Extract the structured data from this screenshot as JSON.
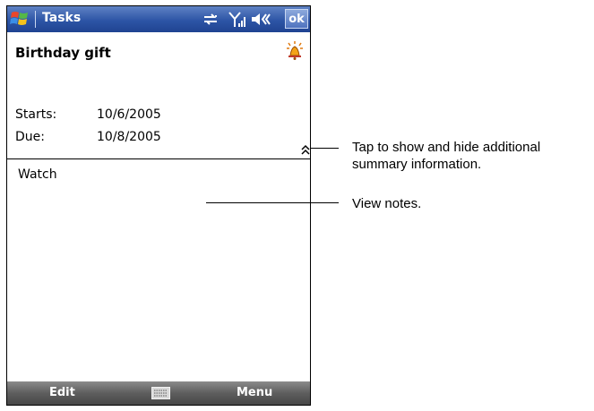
{
  "titlebar": {
    "app_title": "Tasks",
    "ok_label": "ok"
  },
  "task": {
    "subject": "Birthday gift",
    "starts_label": "Starts:",
    "starts_value": "10/6/2005",
    "due_label": "Due:",
    "due_value": "10/8/2005",
    "notes": "Watch"
  },
  "menubar": {
    "left_softkey": "Edit",
    "right_softkey": "Menu"
  },
  "callouts": {
    "toggle_line1": "Tap to show and hide additional",
    "toggle_line2": "summary information.",
    "notes": "View notes."
  },
  "icons": [
    "windows-flag-icon",
    "connectivity-icon",
    "signal-icon",
    "volume-icon",
    "reminder-bell-icon",
    "expand-collapse-icon",
    "keyboard-icon"
  ],
  "colors": {
    "titlebar": "#2d55a6",
    "menubar": "#5e5e5e"
  }
}
